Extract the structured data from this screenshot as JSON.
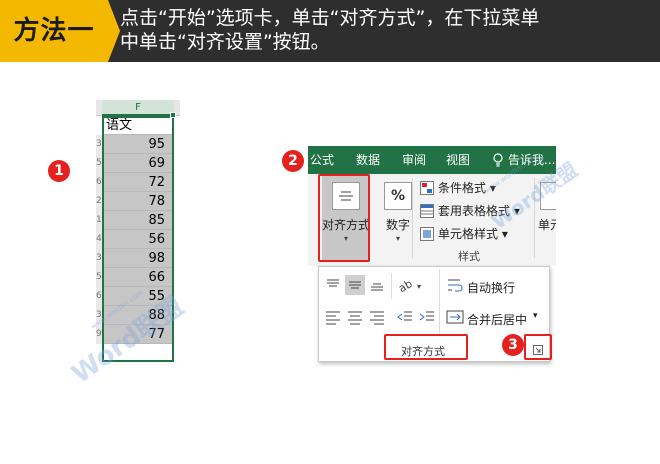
{
  "banner": {
    "tag": "方法一",
    "line1": "点击“开始”选项卡，单击“对齐方式”，在下拉菜单",
    "line2": "中单击“对齐设置”按钮。"
  },
  "colors": {
    "banner_bg": "#2e2e2e",
    "tag_bg": "#f5b800",
    "excel_green": "#217346",
    "step_red": "#e5211d"
  },
  "steps": [
    "1",
    "2",
    "3"
  ],
  "sheet": {
    "column": "F",
    "header": "语文",
    "values": [
      "95",
      "69",
      "72",
      "78",
      "85",
      "56",
      "98",
      "66",
      "55",
      "88",
      "77"
    ],
    "row_stubs": [
      "3",
      "5",
      "6",
      "2",
      "1",
      "4",
      "3",
      "5",
      "6",
      "3",
      "9"
    ]
  },
  "ribbon": {
    "tabs": [
      "公式",
      "数据",
      "审阅",
      "视图"
    ],
    "tell_me": "告诉我...",
    "align_button": "对齐方式",
    "number_button": "数字",
    "number_icon": "%",
    "styles": [
      "条件格式 ▾",
      "套用表格格式 ▾",
      "单元格样式 ▾"
    ],
    "styles_group": "样式",
    "cells_button": "单元"
  },
  "panel": {
    "wrap_text": "自动换行",
    "merge_center": "合并后居中",
    "group_label": "对齐方式"
  },
  "watermark": {
    "main": "Word联盟",
    "sub": "www.wordlm.com"
  }
}
